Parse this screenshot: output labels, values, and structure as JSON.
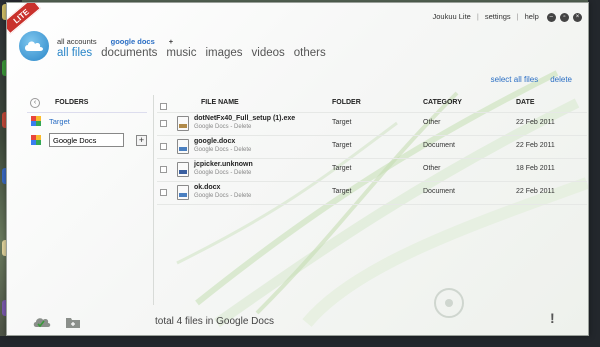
{
  "window": {
    "badge": "LITE",
    "controls": {
      "app_name": "Joukuu Lite",
      "settings": "settings",
      "help": "help",
      "sep": "|"
    }
  },
  "accounts": {
    "all": "all accounts",
    "current": "google docs",
    "add": "+"
  },
  "nav": {
    "tabs": [
      {
        "label": "all files",
        "active": true
      },
      {
        "label": "documents",
        "active": false
      },
      {
        "label": "music",
        "active": false
      },
      {
        "label": "images",
        "active": false
      },
      {
        "label": "videos",
        "active": false
      },
      {
        "label": "others",
        "active": false
      }
    ]
  },
  "actions": {
    "select_all": "select all files",
    "delete": "delete"
  },
  "sidebar": {
    "header": "FOLDERS",
    "back_glyph": "‹",
    "items": [
      {
        "label": "Target",
        "icon": "google-docs-icon"
      }
    ],
    "new_folder_value": "Google Docs",
    "add_label": "+"
  },
  "files": {
    "columns": {
      "name": "FILE NAME",
      "folder": "FOLDER",
      "category": "CATEGORY",
      "date": "DATE"
    },
    "rows": [
      {
        "name": "dotNetFx40_Full_setup (1).exe",
        "source": "Google Docs",
        "sep": " - ",
        "delete": "Delete",
        "folder": "Target",
        "category": "Other",
        "date": "22 Feb 2011",
        "icon": "exe-file-icon"
      },
      {
        "name": "google.docx",
        "source": "Google Docs",
        "sep": " - ",
        "delete": "Delete",
        "folder": "Target",
        "category": "Document",
        "date": "22 Feb 2011",
        "icon": "docx-file-icon"
      },
      {
        "name": "jcpicker.unknown",
        "source": "Google Docs",
        "sep": " - ",
        "delete": "Delete",
        "folder": "Target",
        "category": "Other",
        "date": "18 Feb 2011",
        "icon": "unknown-file-icon"
      },
      {
        "name": "ok.docx",
        "source": "Google Docs",
        "sep": " - ",
        "delete": "Delete",
        "folder": "Target",
        "category": "Document",
        "date": "22 Feb 2011",
        "icon": "docx-file-icon"
      }
    ]
  },
  "status": {
    "text": "total 4 files in Google Docs",
    "alert": "!"
  },
  "colors": {
    "accent": "#2a86c8",
    "link": "#2a6ec4",
    "badge": "#c9312c"
  }
}
